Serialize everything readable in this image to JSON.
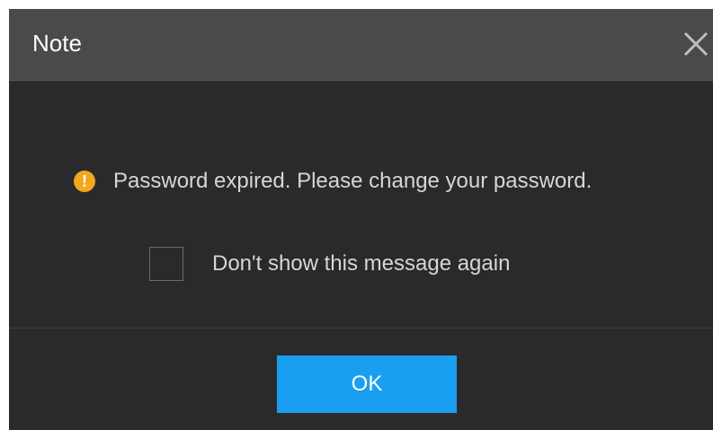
{
  "dialog": {
    "title": "Note",
    "close_icon": "close-icon",
    "message_icon": "warning-icon",
    "message": "Password expired. Please change your password.",
    "checkbox_label": "Don't show this message again",
    "checkbox_checked": false,
    "ok_label": "OK"
  },
  "colors": {
    "titlebar": "#4a4a4d",
    "body": "#2a2a2d",
    "accent": "#1a9ff0",
    "warning": "#f2a81d"
  }
}
